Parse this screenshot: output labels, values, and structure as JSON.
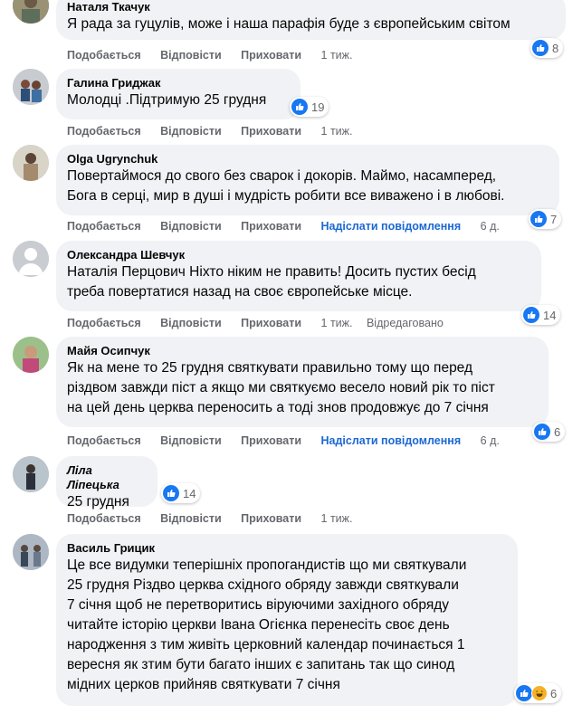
{
  "actions": {
    "like": "Подобається",
    "reply": "Відповісти",
    "hide": "Приховати",
    "send_message": "Надіслати повідомлення",
    "edited": "Відредаговано"
  },
  "colors": {
    "like_blue": "#1877f2",
    "link_blue": "#1c68d4",
    "meta_gray": "#65676b",
    "bubble_bg": "#f0f2f5"
  },
  "comments": [
    {
      "author": "Наталя Ткачук",
      "text": "Я рада за гуцулів, може і наша парафія буде з європейським світом",
      "time": "1 тиж.",
      "reactions": "8",
      "reaction_icons": [
        "like-icon"
      ]
    },
    {
      "author": "Галина Гриджак",
      "text": "Молодці .Підтримую 25 грудня",
      "time": "1 тиж.",
      "reactions": "19",
      "reaction_icons": [
        "like-icon"
      ]
    },
    {
      "author": "Olga Ugrynchuk",
      "text": "Повертаймося до свого без сварок і докорів. Маймо, насамперед,\nБога в серці, мир в душі і мудрість робити все виважено і в любові.",
      "time": "6 д.",
      "reactions": "7",
      "reaction_icons": [
        "like-icon"
      ]
    },
    {
      "author": "Олександра Шевчук",
      "text": "Наталія Перцович Ніхто ніким не править! Досить пустих бесід\nтреба повертатися назад на своє європейське місце.",
      "time": "1 тиж.",
      "reactions": "14",
      "reaction_icons": [
        "like-icon"
      ]
    },
    {
      "author": "Майя Осипчук",
      "text": "Як на мене то 25 грудня святкувати правильно тому що перед\nріздвом завжди піст а якщо ми святкуємо весело новий рік то піст\nна цей день церква переносить а тоді знов продовжує до 7 січня",
      "time": "6 д.",
      "reactions": "6",
      "reaction_icons": [
        "like-icon"
      ]
    },
    {
      "author": "Ліла Ліпецька",
      "text": "25 грудня",
      "time": "1 тиж.",
      "reactions": "14",
      "reaction_icons": [
        "like-icon"
      ]
    },
    {
      "author": "Василь Грицик",
      "text": "Це все видумки теперішніх пропогандистів що ми святкували\n25 грудня Різдво церква східного обряду завжди святкували\n7 січня щоб не перетворитись віруючими західного обряду\nчитайте історію церкви Івана Огієнка перенесіть своє день\nнародження з тим живіть церковний календар починається 1\nвересня як зтим бути багато інших є запитань так що синод\nмідних церков прийняв святкувати 7 січня",
      "time": "",
      "reactions": "6",
      "reaction_icons": [
        "like-icon",
        "haha-icon"
      ]
    }
  ]
}
